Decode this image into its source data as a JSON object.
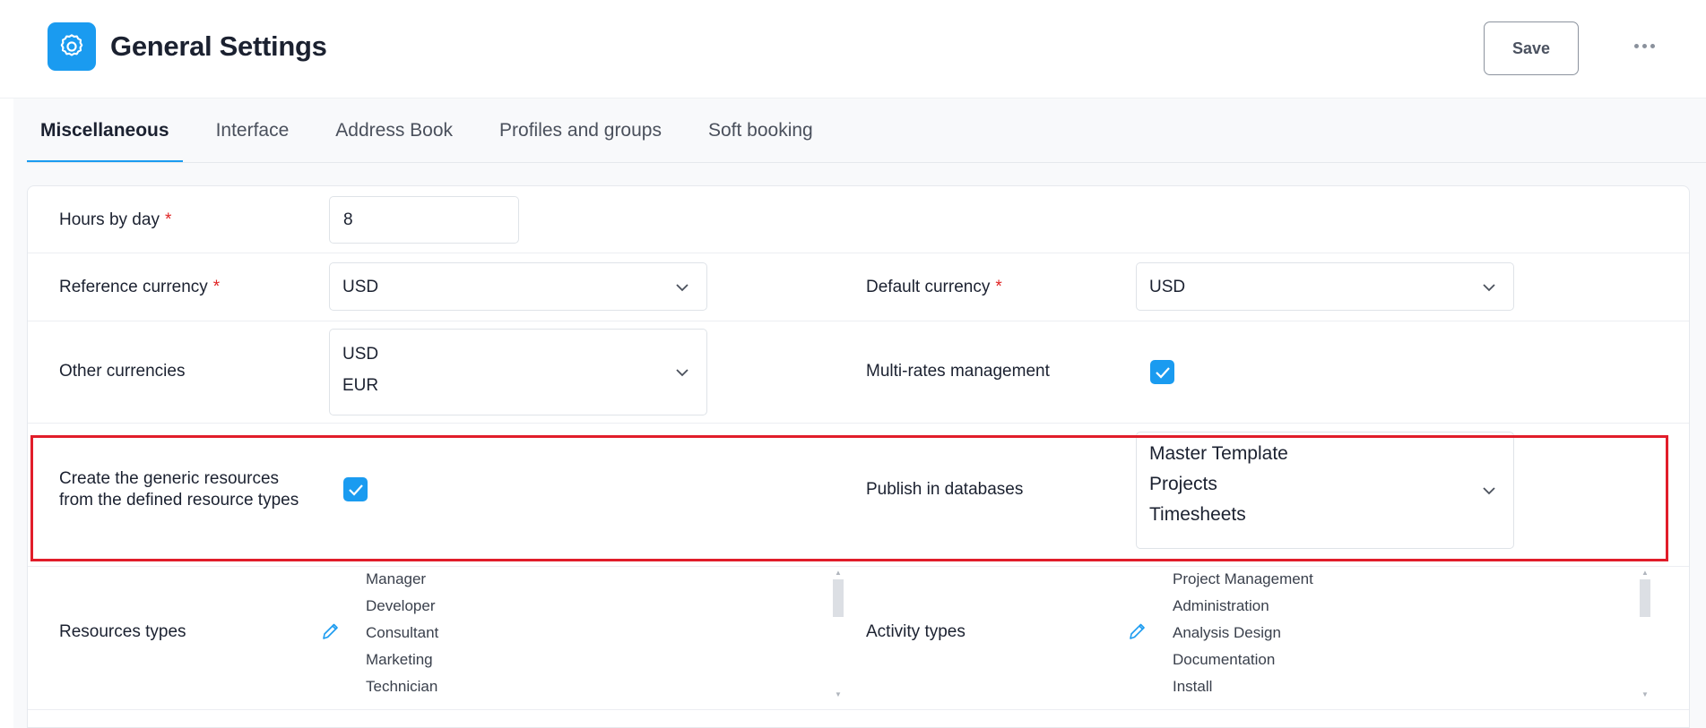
{
  "header": {
    "title": "General Settings",
    "icon": "gear-icon",
    "save_label": "Save"
  },
  "tabs": [
    {
      "label": "Miscellaneous",
      "active": true
    },
    {
      "label": "Interface",
      "active": false
    },
    {
      "label": "Address Book",
      "active": false
    },
    {
      "label": "Profiles and groups",
      "active": false
    },
    {
      "label": "Soft booking",
      "active": false
    }
  ],
  "form": {
    "hours_by_day": {
      "label": "Hours by day",
      "value": "8"
    },
    "reference_currency": {
      "label": "Reference currency",
      "value": "USD"
    },
    "default_currency": {
      "label": "Default currency",
      "value": "USD"
    },
    "other_currencies": {
      "label": "Other currencies",
      "values": [
        "USD",
        "EUR"
      ]
    },
    "multi_rates": {
      "label": "Multi-rates management",
      "checked": true
    },
    "generic_resources": {
      "label_line1": "Create the generic resources",
      "label_line2": "from the defined resource types",
      "checked": true
    },
    "publish_databases": {
      "label": "Publish in databases",
      "values": [
        "Master Template",
        "Projects",
        "Timesheets"
      ]
    },
    "resource_types": {
      "label": "Resources types",
      "items": [
        "Manager",
        "Developer",
        "Consultant",
        "Marketing",
        "Technician"
      ]
    },
    "activity_types": {
      "label": "Activity types",
      "items": [
        "Project Management",
        "Administration",
        "Analysis Design",
        "Documentation",
        "Install"
      ]
    }
  },
  "required_marker": "*",
  "colors": {
    "accent": "#1a9bf0",
    "required": "#e02424",
    "highlight": "#e11d2a"
  }
}
